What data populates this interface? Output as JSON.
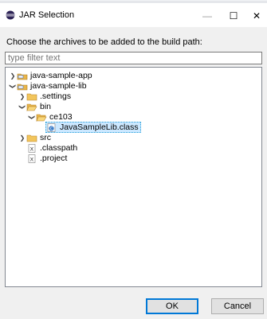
{
  "window": {
    "title": "JAR Selection",
    "controls": {
      "minimize": "—",
      "maximize": "☐",
      "close": "✕"
    }
  },
  "dialog": {
    "description": "Choose the archives to be added to the build path:",
    "filter": {
      "value": "",
      "placeholder": "type filter text"
    }
  },
  "tree": {
    "items": [
      {
        "label": "java-sample-app",
        "icon": "java-project-icon",
        "expanded": false
      },
      {
        "label": "java-sample-lib",
        "icon": "java-project-icon",
        "expanded": true
      },
      {
        "label": ".settings",
        "icon": "folder-icon",
        "expanded": false
      },
      {
        "label": "bin",
        "icon": "open-folder-icon",
        "expanded": true
      },
      {
        "label": "ce103",
        "icon": "open-folder-icon",
        "expanded": true
      },
      {
        "label": "JavaSampleLib.class",
        "icon": "class-file-icon",
        "selected": true
      },
      {
        "label": "src",
        "icon": "folder-icon",
        "expanded": false
      },
      {
        "label": ".classpath",
        "icon": "xml-file-icon"
      },
      {
        "label": ".project",
        "icon": "xml-file-icon"
      }
    ]
  },
  "buttons": {
    "ok": "OK",
    "cancel": "Cancel"
  },
  "colors": {
    "selection": "#cce8ff",
    "focus_border": "#0078d7",
    "folder": "#e8b54a"
  }
}
